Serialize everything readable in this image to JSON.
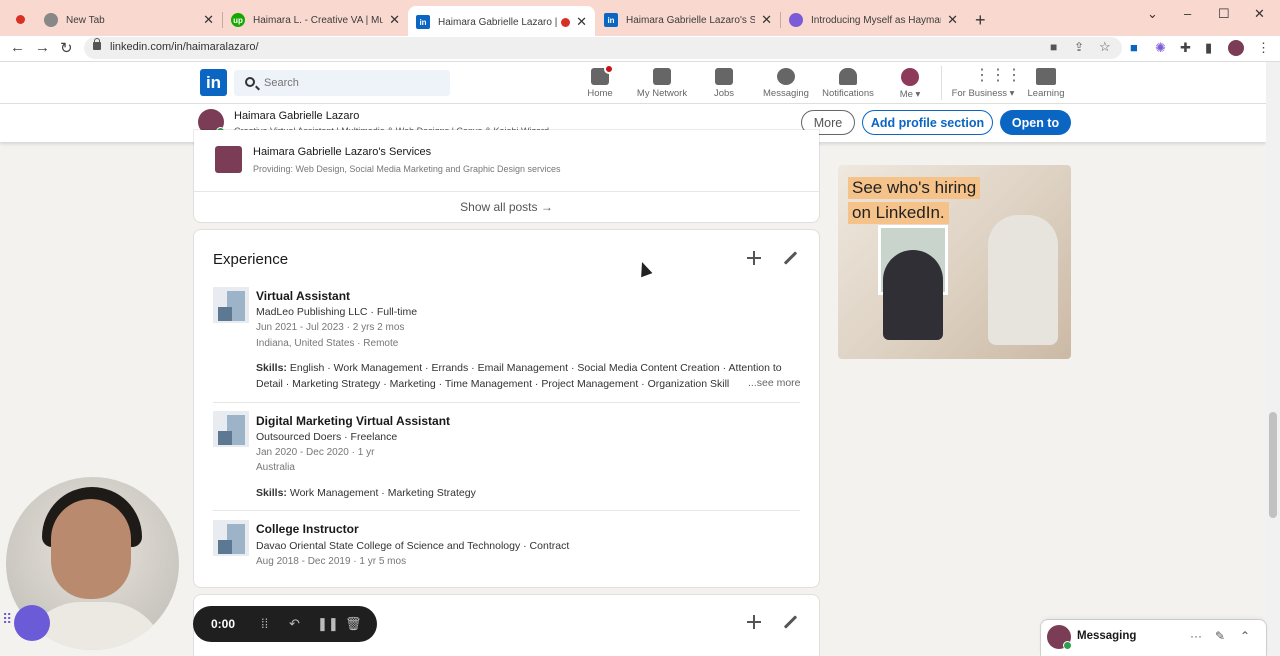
{
  "browser": {
    "tabs": [
      {
        "label": "New Tab",
        "icon": "chrome-icon",
        "color": "#888888"
      },
      {
        "label": "Haimara L. - Creative VA | Multim",
        "icon": "upwork-icon",
        "color": "#14a800"
      },
      {
        "label": "Haimara Gabrielle Lazaro | Li",
        "icon": "linkedin-icon",
        "color": "#0a66c2"
      },
      {
        "label": "Haimara Gabrielle Lazaro's Servi",
        "icon": "linkedin-icon",
        "color": "#0a66c2"
      },
      {
        "label": "Introducing Myself as Haymar Ga",
        "icon": "gear-flower-icon",
        "color": "#7b5bd6"
      }
    ],
    "url": "linkedin.com/in/haimaralazaro/"
  },
  "linkedin": {
    "logo": "in",
    "search_placeholder": "Search",
    "nav": [
      {
        "label": "Home",
        "icon": "home-icon"
      },
      {
        "label": "My Network",
        "icon": "network-icon"
      },
      {
        "label": "Jobs",
        "icon": "briefcase-icon"
      },
      {
        "label": "Messaging",
        "icon": "messaging-icon"
      },
      {
        "label": "Notifications",
        "icon": "bell-icon"
      },
      {
        "label": "Me",
        "icon": "avatar-icon"
      },
      {
        "label": "For Business",
        "icon": "grid-icon"
      },
      {
        "label": "Learning",
        "icon": "learning-icon"
      }
    ]
  },
  "sticky": {
    "name": "Haimara Gabrielle Lazaro",
    "headline": "Creative Virtual Assistant | Multimedia & Web Designs | Canva & Kajabi Wizard",
    "more": "More",
    "add_section": "Add profile section",
    "open_to": "Open to"
  },
  "services": {
    "title": "Haimara Gabrielle Lazaro's Services",
    "subtitle": "Providing: Web Design, Social Media Marketing and Graphic Design services",
    "show_all": "Show all posts →"
  },
  "experience": {
    "title": "Experience",
    "items": [
      {
        "role": "Virtual Assistant",
        "company": "MadLeo Publishing LLC · Full-time",
        "dates": "Jun 2021 - Jul 2023 · 2 yrs 2 mos",
        "location": "Indiana, United States · Remote",
        "skills_label": "Skills:",
        "skills": "English · Work Management · Errands · Email Management · Social Media Content Creation · Attention to Detail · Marketing Strategy · Marketing · Time Management · Project Management · Organization Skill",
        "see_more": "...see more"
      },
      {
        "role": "Digital Marketing Virtual Assistant",
        "company": "Outsourced Doers · Freelance",
        "dates": "Jan 2020 - Dec 2020 · 1 yr",
        "location": "Australia",
        "skills_label": "Skills:",
        "skills": "Work Management · Marketing Strategy"
      },
      {
        "role": "College Instructor",
        "company": "Davao Oriental State College of Science and Technology · Contract",
        "dates": "Aug 2018 - Dec 2019 · 1 yr 5 mos"
      }
    ]
  },
  "ad": {
    "line1": "See who's hiring",
    "line2": "on LinkedIn."
  },
  "recorder": {
    "time": "0:00"
  },
  "messaging": {
    "label": "Messaging"
  }
}
